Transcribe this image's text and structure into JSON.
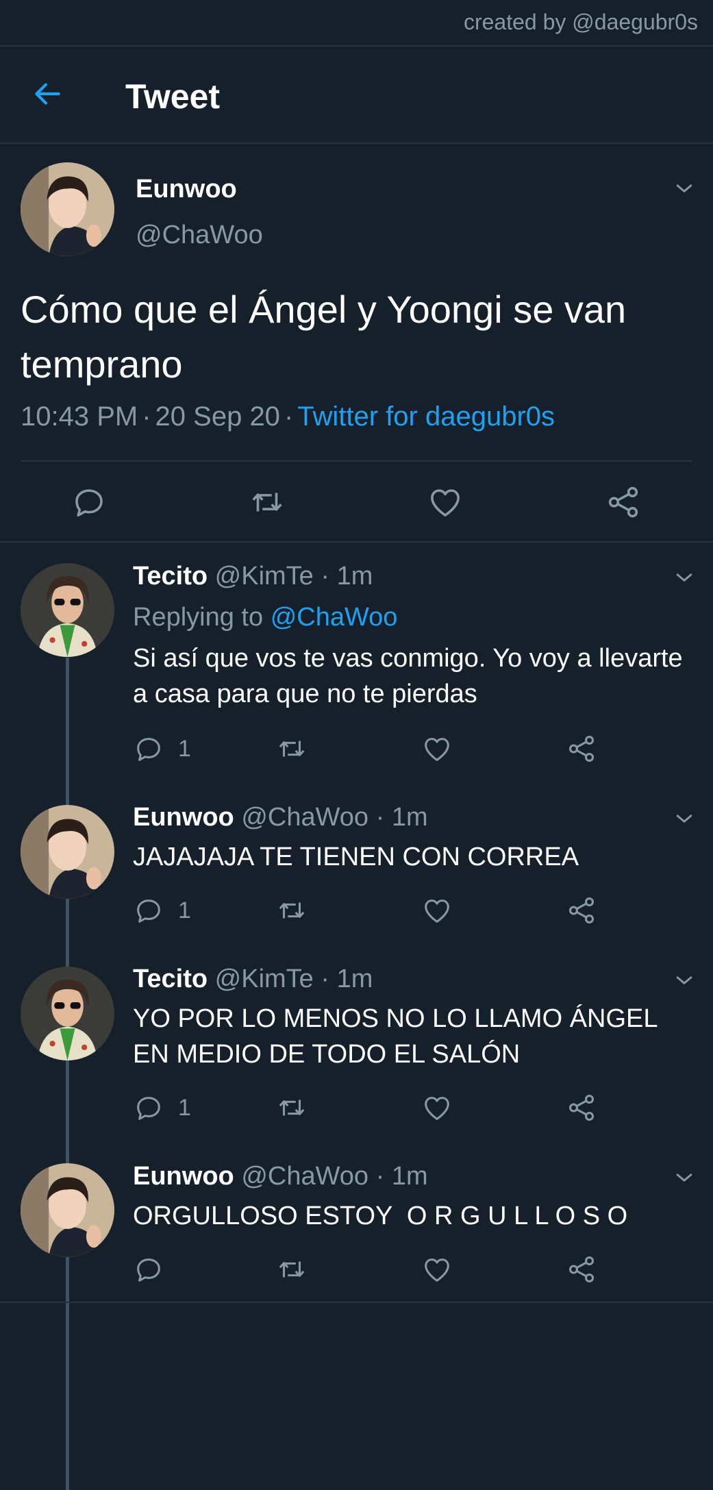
{
  "credit": "created by @daegubr0s",
  "header": {
    "title": "Tweet"
  },
  "main_tweet": {
    "name": "Eunwoo",
    "handle": "@ChaWoo",
    "text": "Cómo que el Ángel y Yoongi se van temprano",
    "time": "10:43 PM",
    "date": "20 Sep 20",
    "source": "Twitter for daegubr0s"
  },
  "replies": [
    {
      "name": "Tecito",
      "handle": "@KimTe",
      "time": "1m",
      "replying_label": "Replying to",
      "replying_to": "@ChaWoo",
      "text": "Si así que vos te vas conmigo. Yo voy a llevarte a casa para que no te pierdas",
      "reply_count": "1"
    },
    {
      "name": "Eunwoo",
      "handle": "@ChaWoo",
      "time": "1m",
      "text": "JAJAJAJA TE TIENEN CON CORREA",
      "reply_count": "1"
    },
    {
      "name": "Tecito",
      "handle": "@KimTe",
      "time": "1m",
      "text": "YO POR LO MENOS NO LO LLAMO ÁNGEL EN MEDIO DE TODO EL SALÓN",
      "reply_count": "1"
    },
    {
      "name": "Eunwoo",
      "handle": "@ChaWoo",
      "time": "1m",
      "text": "ORGULLOSO ESTOY  O R G U L L O S O",
      "reply_count": ""
    }
  ],
  "colors": {
    "background": "#15202b",
    "accent": "#1da1f2",
    "muted": "#8899a6"
  },
  "icons": [
    "back-arrow-icon",
    "chevron-down-icon",
    "reply-icon",
    "retweet-icon",
    "like-icon",
    "share-icon"
  ]
}
